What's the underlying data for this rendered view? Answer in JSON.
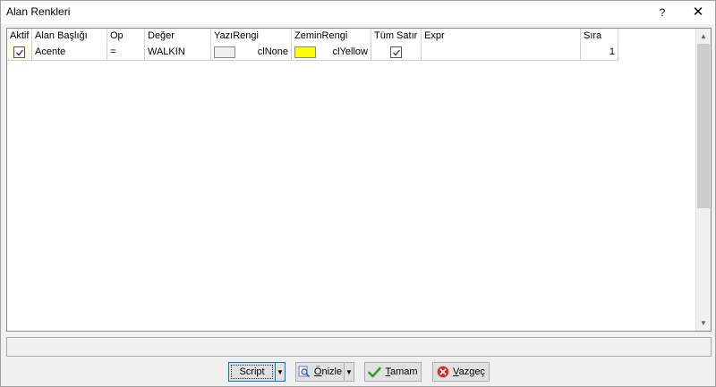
{
  "window": {
    "title": "Alan Renkleri",
    "help_glyph": "?",
    "close_glyph": "✕"
  },
  "grid": {
    "columns": [
      "Aktif",
      "Alan Başlığı",
      "Op",
      "Değer",
      "YazıRengi",
      "ZeminRengi",
      "Tüm Satır",
      "Expr",
      "Sıra"
    ],
    "rows": [
      {
        "aktif": true,
        "alan_basligi": "Acente",
        "op": "=",
        "deger": "WALKIN",
        "yazi_rengi": "clNone",
        "yazi_rengi_swatch": "#f0f0f0",
        "zemin_rengi": "clYellow",
        "zemin_rengi_swatch": "#ffff00",
        "tum_satir": true,
        "expr": "",
        "sira": "1"
      }
    ]
  },
  "status": {
    "text": ""
  },
  "buttons": {
    "script": "Script",
    "onizle_prefix": "",
    "onizle_underlined": "Ö",
    "onizle_rest": "nizle",
    "tamam_underlined": "T",
    "tamam_rest": "amam",
    "vazgec_underlined": "V",
    "vazgec_rest": "azgeç"
  },
  "icons": {
    "onizle": "magnifier-document-icon",
    "tamam": "green-check-icon",
    "vazgec": "red-cancel-icon"
  },
  "colors": {
    "accent": "#0078d7",
    "check_green": "#2e9e2e",
    "cancel_red": "#d92b2b"
  }
}
